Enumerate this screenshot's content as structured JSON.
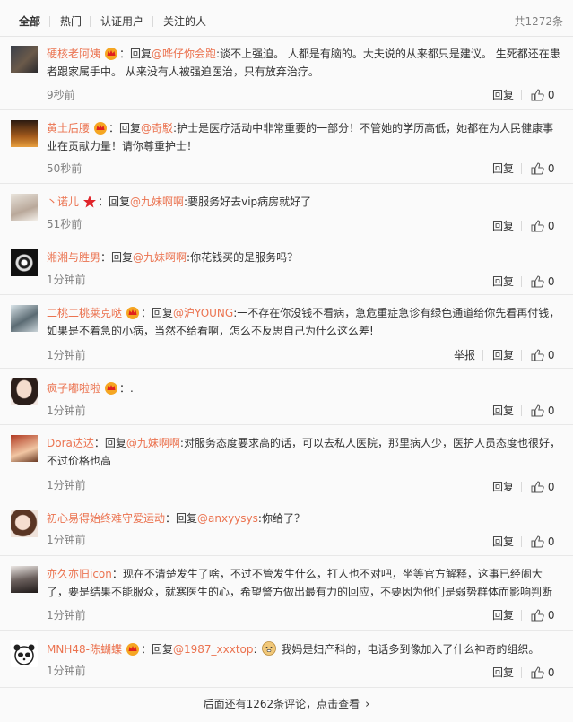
{
  "tabs": {
    "all": "全部",
    "hot": "热门",
    "verified": "认证用户",
    "following": "关注的人",
    "total": "共1272条"
  },
  "labels": {
    "reply": "回复",
    "report": "举报",
    "like_count": "0"
  },
  "comments": [
    {
      "user": "硬核老阿姨",
      "prefix": "：回复",
      "mention": "@哗仔你会跑",
      "text": ":谈不上强迫。 人都是有脑的。大夫说的从来都只是建议。 生死都还在患者跟家属手中。 从来没有人被强迫医治，只有放弃治疗。",
      "time": "9秒前"
    },
    {
      "user": "黄土后腰",
      "prefix": "：回复",
      "mention": "@奇駁",
      "text": ":护士是医疗活动中非常重要的一部分！不管她的学历高低，她都在为人民健康事业在贡献力量！请你尊重护士！",
      "time": "50秒前"
    },
    {
      "user": "丶诺儿",
      "prefix": "：回复",
      "mention": "@九妹啊啊",
      "text": ":要服务好去vip病房就好了",
      "time": "51秒前"
    },
    {
      "user": "湘湘与胜男",
      "prefix": "：回复",
      "mention": "@九妹啊啊",
      "text": ":你花钱买的是服务吗？",
      "time": "1分钟前"
    },
    {
      "user": "二桃二桃莱克哒",
      "prefix": "：回复",
      "mention": "@沪YOUNG",
      "text": ":一不存在你没钱不看病，急危重症急诊有绿色通道给你先看再付钱，如果是不着急的小病，当然不给看啊，怎么不反思自己为什么这么差!",
      "time": "1分钟前"
    },
    {
      "user": "疯子嘟啦啦",
      "prefix": "：.",
      "mention": "",
      "text": "",
      "time": "1分钟前"
    },
    {
      "user": "Dora达达",
      "prefix": "：回复",
      "mention": "@九妹啊啊",
      "text": ":对服务态度要求高的话，可以去私人医院，那里病人少，医护人员态度也很好，不过价格也高",
      "time": "1分钟前"
    },
    {
      "user": "初心易得始终难守爱运动",
      "prefix": "：回复",
      "mention": "@anxyysys",
      "text": ":你给了？",
      "time": "1分钟前"
    },
    {
      "user": "亦久亦旧icon",
      "prefix": "：现在不清楚发生了啥，不过不管发生什么，打人也不对吧，坐等官方解释，这事已经闹大了，要是结果不能服众，就寒医生的心，希望警方做出最有力的回应，不要因为他们是弱势群体而影响判断",
      "mention": "",
      "text": "",
      "time": "1分钟前"
    },
    {
      "user": "MNH48-陈蝴蝶",
      "prefix": "：回复",
      "mention": "@1987_xxxtop",
      "text": "我妈是妇产科的，电话多到像加入了什么神奇的组织。",
      "time": "1分钟前"
    }
  ],
  "more": "后面还有1262条评论，点击查看",
  "colors": {
    "username": "#eb7350",
    "background": "#fafafa",
    "muted": "#808080"
  }
}
